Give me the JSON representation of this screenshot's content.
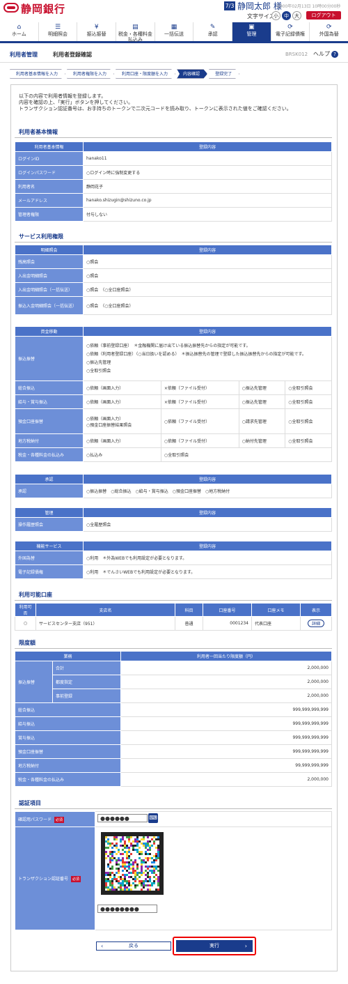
{
  "header": {
    "bank_name": "静岡銀行",
    "user_badge": "7/3",
    "user_name": "静岡太郎 様",
    "last_login": "2000年02月13日 10時00分00秒",
    "font_size_label": "文字サイズ",
    "font_sizes": [
      "小",
      "中",
      "大"
    ],
    "logout_label": "ログアウト"
  },
  "nav": {
    "items": [
      {
        "label": "ホーム",
        "icon": "home-icon",
        "glyph": "⌂"
      },
      {
        "label": "明細照会",
        "icon": "list-icon",
        "glyph": "☰"
      },
      {
        "label": "振込振替",
        "icon": "transfer-icon",
        "glyph": "¥"
      },
      {
        "label": "税金・各種料金払込み",
        "icon": "tax-icon",
        "glyph": "▤"
      },
      {
        "label": "一括伝送",
        "icon": "batch-icon",
        "glyph": "▦"
      },
      {
        "label": "承認",
        "icon": "approve-icon",
        "glyph": "✎"
      },
      {
        "label": "管理",
        "icon": "admin-icon",
        "glyph": "▣"
      },
      {
        "label": "電子記録債権",
        "icon": "denshi-icon",
        "glyph": "⟳"
      },
      {
        "label": "外国為替",
        "icon": "forex-icon",
        "glyph": "⟳"
      }
    ]
  },
  "subheader": {
    "category": "利用者管理",
    "title": "利用者登録確認",
    "screen_code": "BRSK012",
    "help_label": "ヘルプ",
    "help_glyph": "?"
  },
  "steps": [
    "利用者基本情報を入力",
    "利用者権限を入力",
    "利用口座・限度額を入力",
    "内容確認",
    "登録完了"
  ],
  "intro": [
    "以下の内容で利用者情報を登録します。",
    "内容を確認の上、「実行」ボタンを押してください。",
    "トランザクション認証番号は、お手持ちのトークンで二次元コードを読み取り、トークンに表示された値をご確認ください。"
  ],
  "basic": {
    "title": "利用者基本情報",
    "col1": "利用者基本情報",
    "col2": "登録内容",
    "rows": [
      {
        "k": "ログインID",
        "v": "hanako11"
      },
      {
        "k": "ログインパスワード",
        "v": "○ログイン時に強制変更する"
      },
      {
        "k": "利用者名",
        "v": "静岡花子"
      },
      {
        "k": "メールアドレス",
        "v": "hanako.shizugin@shizuno.co.jp"
      },
      {
        "k": "管理者権限",
        "v": "付与しない"
      }
    ]
  },
  "service": {
    "title": "サービス利用権限",
    "inquiry": {
      "col1": "明細照会",
      "col2": "登録内容",
      "rows": [
        {
          "k": "残高照会",
          "v": "○照会"
        },
        {
          "k": "入出金明細照会",
          "v": "○照会"
        },
        {
          "k": "入出金明細照会（一括伝送）",
          "v": "○照会　（○全口座照会）"
        },
        {
          "k": "振込入金明細照会（一括伝送）",
          "v": "○照会　（○全口座照会）"
        }
      ]
    },
    "funds": {
      "col1": "資金移動",
      "col2": "登録内容",
      "transfer_label": "振込振替",
      "transfer_lines": [
        [
          "○依頼（事前登録口座）",
          "＊金融機関に届け出ている振込振替先からの指定が可能です。"
        ],
        [
          "○依頼（利用者登録口座）（○当日扱いを認める）",
          "＊振込振替先の管理で登録した振込振替先からの指定が可能です。"
        ],
        [
          "○振込先管理",
          ""
        ],
        [
          "○全取引照会",
          ""
        ]
      ],
      "rows": [
        {
          "k": "総合振込",
          "c": [
            "○依頼（画面入力）",
            "×依頼（ファイル受付）",
            "○振込先管理",
            "○全取引照会"
          ]
        },
        {
          "k": "給与・賞与振込",
          "c": [
            "○依頼（画面入力）",
            "×依頼（ファイル受付）",
            "○振込先管理",
            "○全取引照会"
          ]
        }
      ],
      "deposit_label": "預金口座振替",
      "deposit_lines": [
        [
          "○依頼（画面入力）",
          "○依頼（ファイル受付）",
          "○請求先管理",
          "○全取引照会"
        ],
        [
          "○預金口座振替結果照会",
          "",
          "",
          ""
        ]
      ],
      "local_tax": {
        "k": "地方税納付",
        "c": [
          "○依頼（画面入力）",
          "○依頼（ファイル受付）",
          "○納付先管理",
          "○全取引照会"
        ]
      },
      "tax_fee": {
        "k": "税金・各種料金の払込み",
        "c": [
          "○払込み",
          "○全取引照会",
          "",
          ""
        ]
      }
    },
    "approve": {
      "col1": "承認",
      "col2": "登録内容",
      "k": "承認",
      "v": "○振込振替　○総合振込　○給与・賞与振込　○預金口座振替　○地方税納付"
    },
    "manage": {
      "col1": "管理",
      "col2": "登録内容",
      "k": "操作履歴照会",
      "v": "○全履歴照会"
    },
    "linked": {
      "col1": "機能サービス",
      "col2": "登録内容",
      "rows": [
        {
          "k": "外国為替",
          "v": "○利用　＊外為WEBでも利用設定が必要となります。"
        },
        {
          "k": "電子記録債権",
          "v": "○利用　＊でんさいWEBでも利用設定が必要となります。"
        }
      ]
    }
  },
  "accounts": {
    "title": "利用可能口座",
    "headers": [
      "利用可否",
      "支店名",
      "科目",
      "口座番号",
      "口座メモ",
      "表示"
    ],
    "rows": [
      {
        "avail": "○",
        "branch": "サービスセンター支店（951）",
        "type": "普通",
        "number": "0001234",
        "memo": "代表口座",
        "action": "詳細"
      }
    ]
  },
  "limits": {
    "title": "限度額",
    "col1": "業務",
    "col2": "利用者一回当たり限度額（円）",
    "transfer_label": "振込振替",
    "transfer_rows": [
      {
        "k": "合計",
        "v": "2,000,000"
      },
      {
        "k": "都度指定",
        "v": "2,000,000"
      },
      {
        "k": "事前登録",
        "v": "2,000,000"
      }
    ],
    "rows": [
      {
        "k": "総合振込",
        "v": "999,999,999,999"
      },
      {
        "k": "給与振込",
        "v": "999,999,999,999"
      },
      {
        "k": "賞与振込",
        "v": "999,999,999,999"
      },
      {
        "k": "預金口座振替",
        "v": "999,999,999,999"
      },
      {
        "k": "地方税納付",
        "v": "99,999,999,999"
      },
      {
        "k": "税金・各種料金の払込み",
        "v": "2,000,000"
      }
    ]
  },
  "auth": {
    "title": "認証項目",
    "pw_label": "確認用パスワード",
    "pw_value": "●●●●●●",
    "tx_label": "トランザクション認証番号",
    "tx_value": "●●●●●●●●",
    "required": "必須",
    "kbd_glyph": "⌨"
  },
  "buttons": {
    "back": "戻る",
    "back_glyph": "‹",
    "exec": "実行",
    "exec_glyph": "›"
  }
}
